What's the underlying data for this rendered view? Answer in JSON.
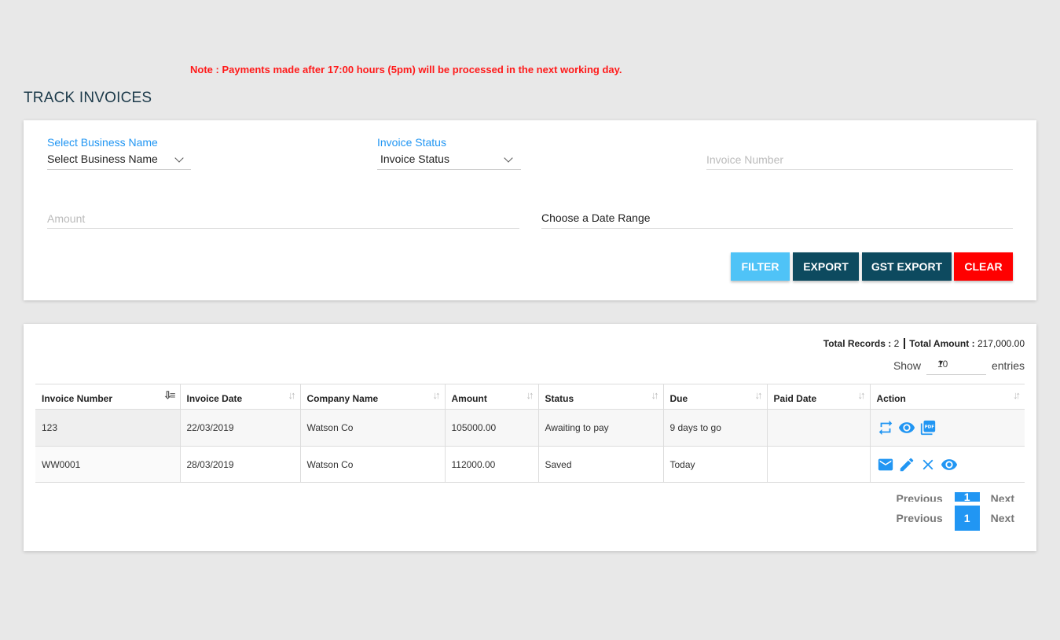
{
  "note": "Note : Payments made after 17:00 hours (5pm) will be processed in the next working day.",
  "page_title": "TRACK INVOICES",
  "filters": {
    "business": {
      "label": "Select Business Name",
      "value": "Select Business Name"
    },
    "status": {
      "label": "Invoice Status",
      "value": "Invoice Status"
    },
    "invoice_number_placeholder": "Invoice Number",
    "amount_placeholder": "Amount",
    "date_range": "Choose a Date Range"
  },
  "buttons": {
    "filter": "FILTER",
    "export": "EXPORT",
    "gst_export": "GST EXPORT",
    "clear": "CLEAR"
  },
  "summary": {
    "records_label": "Total Records :",
    "records_value": "2",
    "amount_label": "Total Amount :",
    "amount_value": "217,000.00"
  },
  "show_entries": {
    "show": "Show",
    "value": "10",
    "entries": "entries"
  },
  "table": {
    "headers": [
      "Invoice Number",
      "Invoice Date",
      "Company Name",
      "Amount",
      "Status",
      "Due",
      "Paid Date",
      "Action"
    ],
    "rows": [
      {
        "invoice_number": "123",
        "invoice_date": "22/03/2019",
        "company": "Watson Co",
        "amount": "105000.00",
        "status": "Awaiting to pay",
        "due": "9 days to go",
        "paid_date": "",
        "actions": [
          "repeat-icon",
          "view-icon",
          "pdf-icon"
        ]
      },
      {
        "invoice_number": "WW0001",
        "invoice_date": "28/03/2019",
        "company": "Watson Co",
        "amount": "112000.00",
        "status": "Saved",
        "due": "Today",
        "paid_date": "",
        "actions": [
          "email-icon",
          "edit-icon",
          "delete-icon",
          "view-icon"
        ]
      }
    ]
  },
  "pagination": {
    "previous": "Previous",
    "page": "1",
    "next": "Next"
  },
  "colors": {
    "accent": "#2196f3",
    "note_red": "#ff1a1a",
    "dark_teal": "#0d4a5f",
    "filter_blue": "#4fc3f7",
    "clear_red": "#ff0000"
  }
}
